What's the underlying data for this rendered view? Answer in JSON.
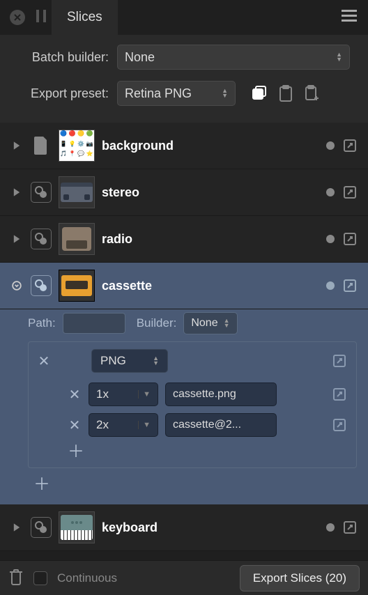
{
  "tab": {
    "title": "Slices"
  },
  "settings": {
    "batch_label": "Batch builder:",
    "batch_value": "None",
    "preset_label": "Export preset:",
    "preset_value": "Retina PNG"
  },
  "slices": [
    {
      "name": "background",
      "type": "page",
      "expanded": false
    },
    {
      "name": "stereo",
      "type": "group",
      "expanded": false
    },
    {
      "name": "radio",
      "type": "group",
      "expanded": false
    },
    {
      "name": "cassette",
      "type": "group",
      "expanded": true,
      "selected": true,
      "detail": {
        "path_label": "Path:",
        "path_value": "",
        "builder_label": "Builder:",
        "builder_value": "None",
        "format": "PNG",
        "scales": [
          {
            "scale": "1x",
            "filename": "cassette.png"
          },
          {
            "scale": "2x",
            "filename": "cassette@2..."
          }
        ]
      }
    },
    {
      "name": "keyboard",
      "type": "group",
      "expanded": false
    }
  ],
  "footer": {
    "continuous_label": "Continuous",
    "export_label": "Export Slices (20)"
  }
}
